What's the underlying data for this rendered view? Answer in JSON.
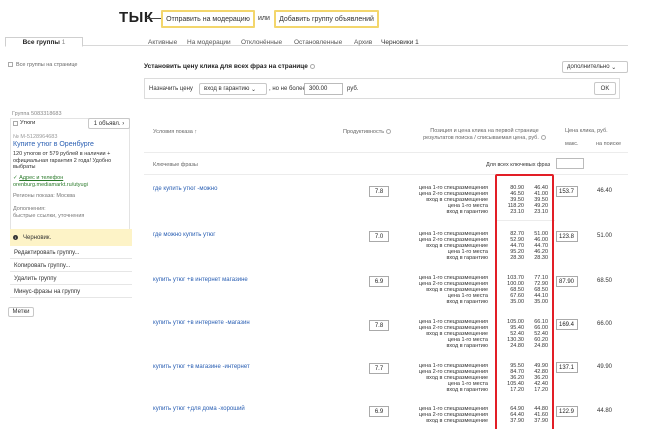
{
  "annotation": {
    "label": "ТЫК",
    "moderation_button": "Отправить на модерацию",
    "or_text": "или",
    "add_group_button": "Добавить группу объявлений"
  },
  "tabs": {
    "all_groups": "Все группы",
    "all_groups_count": "1",
    "items": [
      "Активные",
      "На модерации",
      "Отклонённые",
      "Остановленные",
      "Архив",
      "Черновики 1"
    ]
  },
  "sidebar": {
    "all_groups_checkbox": "Все группы на странице",
    "group_id": "Группа 5083318683",
    "utyugi": "Утюги",
    "ads_button": "1 объявл.",
    "ad_number": "№ M-5128964683",
    "ad_title": "Купите утюг в Оренбурге",
    "ad_text": "120 утюгов от 579 рублей в наличии + официальная гарантия 2 года! Удобно выбраты",
    "address_link": "Адрес и телефон",
    "url": "orenburg.mediamarkt.ru/utyugi",
    "regions": "Регионы показа: Москва",
    "additions_label": "Дополнения:",
    "additions": "быстрые ссылки, уточнения",
    "status": "Черновик.",
    "menu": [
      "Редактировать группу...",
      "Копировать группу...",
      "Удалить группу",
      "Минус-фразы на группу"
    ],
    "tags_button": "Метки"
  },
  "settings": {
    "title": "Установить цену клика для всех фраз на странице",
    "advanced_dropdown": "дополнительно",
    "assign_label": "Назначить цену",
    "mode_dropdown": "вход в гарантию",
    "limit_label": ", но не более",
    "limit_value": "300.00",
    "currency": "руб.",
    "ok_button": "OK"
  },
  "table": {
    "col_conditions": "Условия показа ↑",
    "col_productivity": "Продуктивность",
    "col_position": "Позиция и цена клика на первой странице результатов поиска / списываемая цена, руб.",
    "col_bid": "Цена клика, руб.",
    "col_max": "макс.",
    "col_on_search": "на поиске",
    "keyphrases_label": "Ключевые фразы",
    "all_phrases_label": "Для всех ключевых фраз",
    "rows": [
      {
        "keyword": "где купить утюг  -можно",
        "productivity": "7.8",
        "labels": [
          "цена 1-го спецразмещения",
          "цена 2-го спецразмещения",
          "вход в спецразмещение",
          "цена 1-го места",
          "вход в гарантию"
        ],
        "bids": [
          "80.90",
          "46.50",
          "39.50",
          "118.20",
          "23.10"
        ],
        "charges": [
          "46.40",
          "41.00",
          "39.50",
          "49.20",
          "23.10"
        ],
        "max_bid": "153.7",
        "search_price": "46.40"
      },
      {
        "keyword": "где можно купить утюг",
        "productivity": "7.0",
        "labels": [
          "цена 1-го спецразмещения",
          "цена 2-го спецразмещения",
          "вход в спецразмещение",
          "цена 1-го места",
          "вход в гарантию"
        ],
        "bids": [
          "82.70",
          "52.90",
          "44.70",
          "95.20",
          "28.30"
        ],
        "charges": [
          "51.00",
          "46.00",
          "44.70",
          "46.20",
          "28.30"
        ],
        "max_bid": "123.8",
        "search_price": "51.00"
      },
      {
        "keyword": "купить утюг +в интернет магазине",
        "productivity": "6.9",
        "labels": [
          "цена 1-го спецразмещения",
          "цена 2-го спецразмещения",
          "вход в спецразмещение",
          "цена 1-го места",
          "вход в гарантию"
        ],
        "bids": [
          "103.70",
          "100.00",
          "68.50",
          "67.60",
          "35.00"
        ],
        "charges": [
          "77.10",
          "72.90",
          "68.50",
          "44.10",
          "35.00"
        ],
        "max_bid": "87.90",
        "search_price": "68.50"
      },
      {
        "keyword": "купить утюг +в интернете  -магазин",
        "productivity": "7.8",
        "labels": [
          "цена 1-го спецразмещения",
          "цена 2-го спецразмещения",
          "вход в спецразмещение",
          "цена 1-го места",
          "вход в гарантию"
        ],
        "bids": [
          "105.00",
          "95.40",
          "52.40",
          "130.30",
          "24.80"
        ],
        "charges": [
          "66.10",
          "66.00",
          "52.40",
          "60.20",
          "24.80"
        ],
        "max_bid": "169.4",
        "search_price": "66.00"
      },
      {
        "keyword": "купить утюг +в магазине  -интернет",
        "productivity": "7.7",
        "labels": [
          "цена 1-го спецразмещения",
          "цена 2-го спецразмещения",
          "вход в спецразмещение",
          "цена 1-го места",
          "вход в гарантию"
        ],
        "bids": [
          "95.50",
          "84.70",
          "36.20",
          "105.40",
          "17.20"
        ],
        "charges": [
          "49.90",
          "42.80",
          "36.20",
          "42.40",
          "17.20"
        ],
        "max_bid": "137.1",
        "search_price": "49.90"
      },
      {
        "keyword": "купить утюг +для дома  -хороший",
        "productivity": "6.9",
        "labels": [
          "цена 1-го спецразмещения",
          "цена 2-го спецразмещения",
          "вход в спецразмещение"
        ],
        "bids": [
          "64.90",
          "64.40",
          "37.90"
        ],
        "charges": [
          "44.80",
          "41.60",
          "37.90"
        ],
        "max_bid": "122.9",
        "search_price": "44.80"
      }
    ]
  },
  "colors": {
    "highlight_border": "#f3d66c",
    "draft_bg": "#fdf3c7",
    "link_blue": "#2a5fb3",
    "annotation_red": "#e21e26"
  }
}
